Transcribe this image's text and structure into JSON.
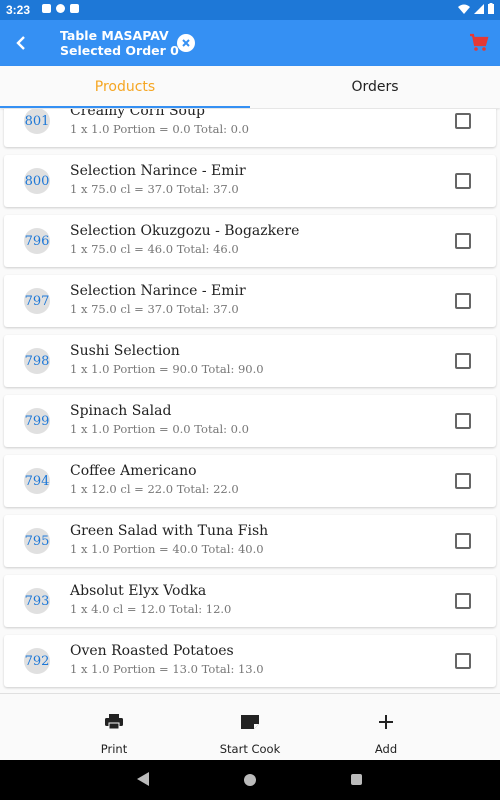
{
  "status": {
    "time": "3:23",
    "icons_left": [
      "a-icon",
      "s-icon",
      "sd-card-icon"
    ],
    "icons_right": [
      "wifi-icon",
      "cell-signal-icon",
      "battery-icon"
    ]
  },
  "appbar": {
    "title": "Table MASAPAV",
    "subtitle": "Selected Order 0",
    "back_icon": "arrow-back-icon",
    "clear_icon": "close-circle-icon",
    "cart_icon": "cart-icon",
    "colors": {
      "bar": "#3590f3",
      "cart": "#e53935",
      "status": "#1e78d7"
    }
  },
  "tabs": [
    {
      "label": "Products",
      "active": true
    },
    {
      "label": "Orders",
      "active": false
    }
  ],
  "items": [
    {
      "id": "801",
      "name": "Creamy Corn Soup",
      "detail": "1 x 1.0 Portion = 0.0 Total: 0.0"
    },
    {
      "id": "800",
      "name": "Selection Narince - Emir",
      "detail": "1 x 75.0 cl = 37.0 Total: 37.0"
    },
    {
      "id": "796",
      "name": "Selection Okuzgozu - Bogazkere",
      "detail": "1 x 75.0 cl = 46.0 Total: 46.0"
    },
    {
      "id": "797",
      "name": "Selection Narince - Emir",
      "detail": "1 x 75.0 cl = 37.0 Total: 37.0"
    },
    {
      "id": "798",
      "name": "Sushi Selection",
      "detail": "1 x 1.0 Portion = 90.0 Total: 90.0"
    },
    {
      "id": "799",
      "name": "Spinach Salad",
      "detail": "1 x 1.0 Portion = 0.0 Total: 0.0"
    },
    {
      "id": "794",
      "name": "Coffee Americano",
      "detail": "1 x 12.0 cl = 22.0 Total: 22.0"
    },
    {
      "id": "795",
      "name": "Green Salad with Tuna Fish",
      "detail": "1 x 1.0 Portion = 40.0 Total: 40.0"
    },
    {
      "id": "793",
      "name": "Absolut Elyx Vodka",
      "detail": "1 x 4.0 cl = 12.0 Total: 12.0"
    },
    {
      "id": "792",
      "name": "Oven Roasted Potatoes",
      "detail": "1 x 1.0 Portion = 13.0 Total: 13.0"
    }
  ],
  "actions": [
    {
      "label": "Print",
      "icon": "printer-icon"
    },
    {
      "label": "Start Cook",
      "icon": "note-icon"
    },
    {
      "label": "Add",
      "icon": "plus-icon"
    }
  ],
  "navbar": {
    "icons": [
      "nav-back-icon",
      "nav-home-icon",
      "nav-recents-icon"
    ]
  }
}
